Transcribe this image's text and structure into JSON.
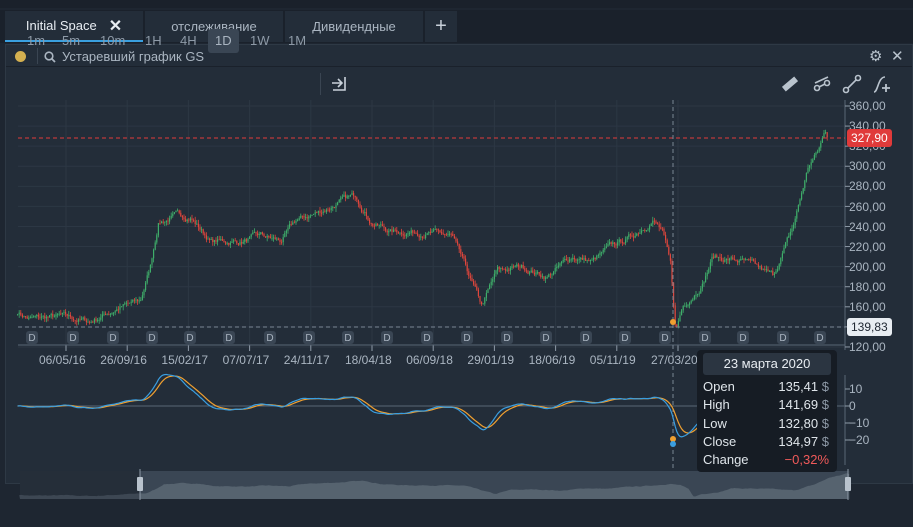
{
  "tabs": [
    {
      "label": "Initial Space",
      "active": true,
      "close": "✕"
    },
    {
      "label": "отслеживание"
    },
    {
      "label": "Дивидендные"
    }
  ],
  "add_tab": "+",
  "header": {
    "search_text": "Устаревший график GS",
    "status_color": "#d4b050"
  },
  "intervals": [
    "1m",
    "5m",
    "10m",
    "1H",
    "4H",
    "1D",
    "1W",
    "1M"
  ],
  "selected_interval": "1D",
  "tools": [
    "ruler-icon",
    "trend-channel-icon",
    "trend-line-icon",
    "add-indicator-icon"
  ],
  "price_axis": [
    "360,00",
    "340,00",
    "320,00",
    "300,00",
    "280,00",
    "260,00",
    "240,00",
    "220,00",
    "200,00",
    "180,00",
    "160,00",
    "140,00",
    "120,00"
  ],
  "last_price": {
    "label": "327,90",
    "color": "#e03a3a"
  },
  "crosshair_price": {
    "label": "139,83"
  },
  "date_axis": [
    "06/05/16",
    "26/09/16",
    "15/02/17",
    "07/07/17",
    "24/11/17",
    "18/04/18",
    "06/09/18",
    "29/01/19",
    "18/06/19",
    "05/11/19",
    "27/03/20"
  ],
  "dividend_marker": "D",
  "oscillator_axis": [
    "10",
    "0",
    "−10",
    "−20"
  ],
  "tooltip": {
    "date": "23 марта 2020",
    "currency": "$",
    "rows": [
      {
        "label": "Open",
        "value": "135,41"
      },
      {
        "label": "High",
        "value": "141,69"
      },
      {
        "label": "Low",
        "value": "132,80"
      },
      {
        "label": "Close",
        "value": "134,97"
      }
    ],
    "change_label": "Change",
    "change_value": "−0,32%",
    "change_color": "#f05a5a"
  },
  "colors": {
    "up": "#3fae6a",
    "down": "#e0463c",
    "osc_fast": "#3a9ee0",
    "osc_slow": "#f0a030"
  },
  "close_keypoints": [
    [
      "2016-01-17",
      155
    ],
    [
      "2016-02-14",
      148
    ],
    [
      "2016-04-24",
      150
    ],
    [
      "2016-07-03",
      145
    ],
    [
      "2016-09-11",
      160
    ],
    [
      "2016-10-28",
      165
    ],
    [
      "2016-11-20",
      200
    ],
    [
      "2016-12-09",
      245
    ],
    [
      "2017-01-17",
      250
    ],
    [
      "2017-02-21",
      250
    ],
    [
      "2017-04-09",
      225
    ],
    [
      "2017-06-18",
      225
    ],
    [
      "2017-08-03",
      230
    ],
    [
      "2017-09-19",
      225
    ],
    [
      "2017-10-24",
      245
    ],
    [
      "2017-12-21",
      255
    ],
    [
      "2018-02-06",
      265
    ],
    [
      "2018-03-13",
      270
    ],
    [
      "2018-04-17",
      245
    ],
    [
      "2018-06-02",
      235
    ],
    [
      "2018-08-11",
      235
    ],
    [
      "2018-10-20",
      230
    ],
    [
      "2018-11-24",
      195
    ],
    [
      "2018-12-29",
      160
    ],
    [
      "2019-02-02",
      195
    ],
    [
      "2019-04-01",
      200
    ],
    [
      "2019-05-29",
      190
    ],
    [
      "2019-07-27",
      210
    ],
    [
      "2019-09-11",
      205
    ],
    [
      "2019-10-28",
      220
    ],
    [
      "2019-12-13",
      230
    ],
    [
      "2020-01-29",
      248
    ],
    [
      "2020-02-21",
      235
    ],
    [
      "2020-03-11",
      200
    ],
    [
      "2020-03-23",
      135
    ],
    [
      "2020-04-08",
      160
    ],
    [
      "2020-05-25",
      185
    ],
    [
      "2020-06-17",
      210
    ],
    [
      "2020-08-26",
      205
    ],
    [
      "2020-11-04",
      190
    ],
    [
      "2020-12-21",
      240
    ],
    [
      "2021-01-25",
      300
    ],
    [
      "2021-02-17",
      315
    ],
    [
      "2021-03-05",
      335
    ],
    [
      "2021-03-12",
      328
    ]
  ]
}
